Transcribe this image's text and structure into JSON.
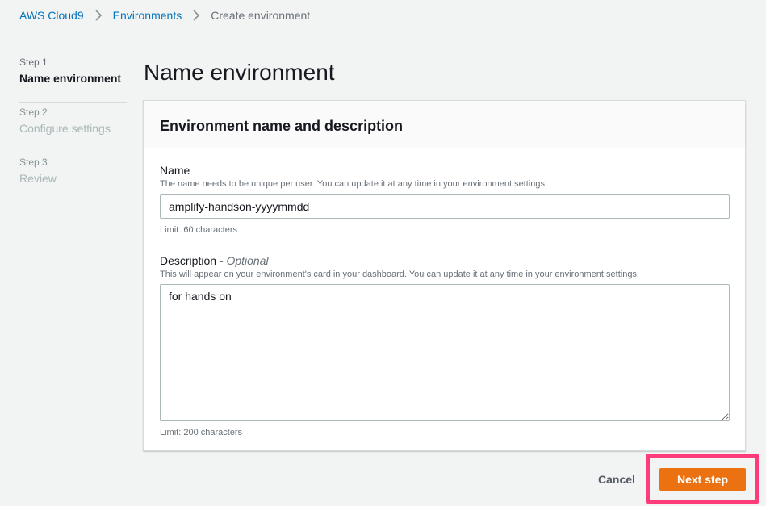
{
  "breadcrumb": {
    "items": [
      {
        "label": "AWS Cloud9"
      },
      {
        "label": "Environments"
      },
      {
        "label": "Create environment"
      }
    ]
  },
  "steps": [
    {
      "num": "Step 1",
      "title": "Name environment",
      "active": true
    },
    {
      "num": "Step 2",
      "title": "Configure settings",
      "active": false
    },
    {
      "num": "Step 3",
      "title": "Review",
      "active": false
    }
  ],
  "page": {
    "title": "Name environment"
  },
  "form": {
    "header": "Environment name and description",
    "name": {
      "label": "Name",
      "hint": "The name needs to be unique per user. You can update it at any time in your environment settings.",
      "value": "amplify-handson-yyyymmdd",
      "constraint": "Limit: 60 characters"
    },
    "description": {
      "label": "Description",
      "optional": "- Optional",
      "hint": "This will appear on your environment's card in your dashboard. You can update it at any time in your environment settings.",
      "value": "for hands on",
      "constraint": "Limit: 200 characters"
    }
  },
  "footer": {
    "cancel_label": "Cancel",
    "next_label": "Next step"
  },
  "colors": {
    "link": "#0073bb",
    "primary": "#ec7211",
    "highlight": "#ff3b7a"
  }
}
